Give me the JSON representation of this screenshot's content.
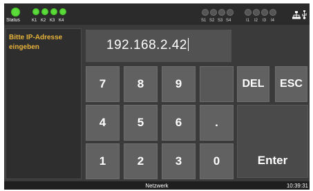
{
  "status_bar": {
    "status_label": "Status",
    "k_labels": [
      "K1",
      "K2",
      "K3",
      "K4"
    ],
    "s_labels": [
      "S1",
      "S2",
      "S3",
      "S4"
    ],
    "i_labels": [
      "I1",
      "I2",
      "I3",
      "I4"
    ],
    "network_icon": "network-icon",
    "usb_icon": "usb-icon",
    "led_on_color": "#5bdc3a"
  },
  "prompt": "Bitte IP-Adresse\neingeben",
  "ip_value": "192.168.2.42",
  "keypad": {
    "keys": [
      "7",
      "8",
      "9",
      "",
      "4",
      "5",
      "6",
      ".",
      "1",
      "2",
      "3",
      "0"
    ],
    "del": "DEL",
    "esc": "ESC",
    "enter": "Enter"
  },
  "footer": {
    "title": "Netzwerk",
    "time": "10:39:31"
  },
  "colors": {
    "prompt": "#e8b33a",
    "background": "#3a3a3a"
  }
}
